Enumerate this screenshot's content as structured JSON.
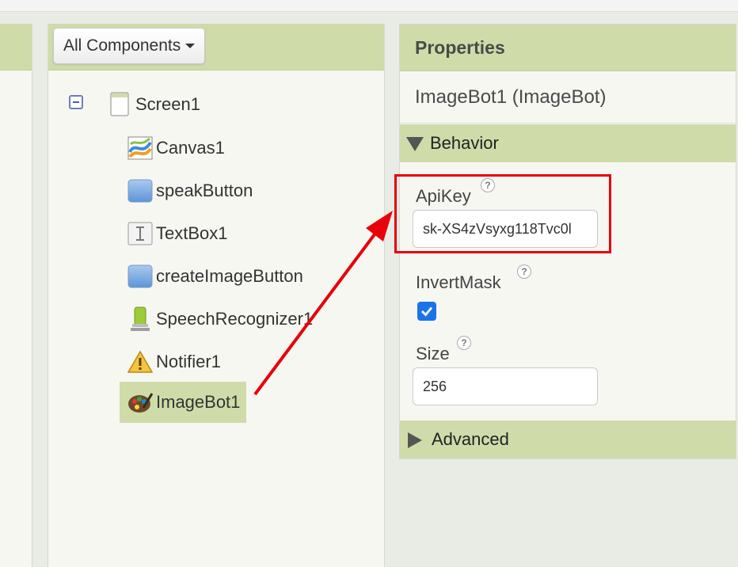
{
  "components_panel": {
    "dropdown_label": "All Components",
    "tree": [
      {
        "label": "Screen1",
        "icon": "screen-icon"
      },
      {
        "label": "Canvas1",
        "icon": "canvas-icon"
      },
      {
        "label": "speakButton",
        "icon": "button-icon"
      },
      {
        "label": "TextBox1",
        "icon": "textbox-icon"
      },
      {
        "label": "createImageButton",
        "icon": "button-icon"
      },
      {
        "label": "SpeechRecognizer1",
        "icon": "speech-recognizer-icon"
      },
      {
        "label": "Notifier1",
        "icon": "notifier-warning-icon"
      },
      {
        "label": "ImageBot1",
        "icon": "imagebot-palette-icon",
        "selected": true
      }
    ]
  },
  "properties_panel": {
    "header": "Properties",
    "component_title": "ImageBot1 (ImageBot)",
    "behavior_section": "Behavior",
    "advanced_section": "Advanced",
    "apikey": {
      "label": "ApiKey",
      "value": "sk-XS4zVsyxg118Tvc0l"
    },
    "invertmask": {
      "label": "InvertMask",
      "checked": true
    },
    "size": {
      "label": "Size",
      "value": "256"
    },
    "help_glyph": "?"
  },
  "annotation": {
    "highlight_color": "#e8000b"
  },
  "colors": {
    "panel_header": "#cfdcaa",
    "checkbox_accent": "#1a73e8"
  }
}
